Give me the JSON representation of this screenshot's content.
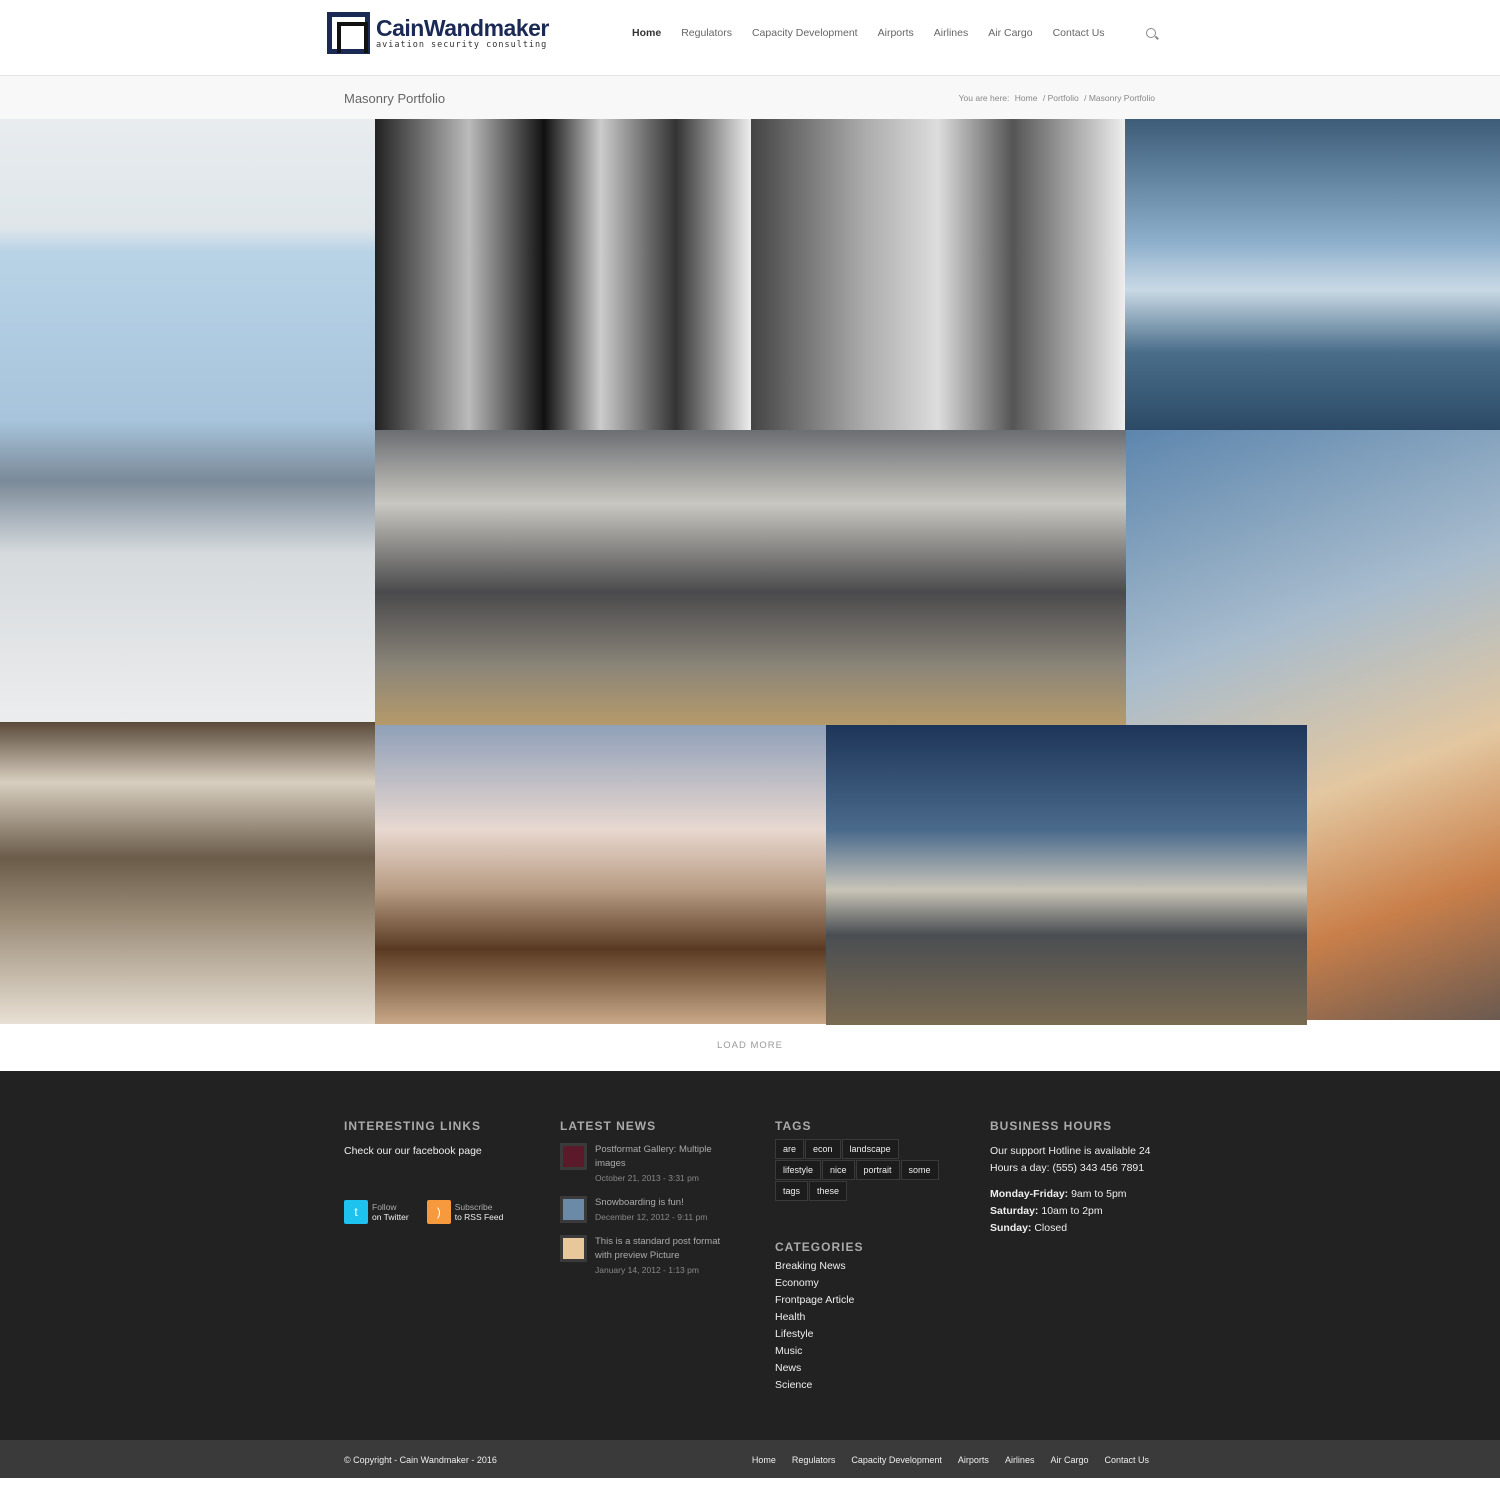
{
  "brand": {
    "name": "CainWandmaker",
    "tagline": "aviation security consulting"
  },
  "nav": [
    "Home",
    "Regulators",
    "Capacity Development",
    "Airports",
    "Airlines",
    "Air Cargo",
    "Contact Us"
  ],
  "page_title": "Masonry Portfolio",
  "breadcrumb": {
    "prefix": "You are here:",
    "items": [
      "Home",
      "/ Portfolio",
      "/ Masonry Portfolio"
    ]
  },
  "load_more": "LOAD MORE",
  "footer": {
    "links": {
      "title": "INTERESTING LINKS",
      "text": "Check our our facebook page",
      "twitter": [
        "Follow",
        "on Twitter"
      ],
      "rss": [
        "Subscribe",
        "to RSS Feed"
      ]
    },
    "news": {
      "title": "LATEST NEWS",
      "items": [
        {
          "title": "Postformat Gallery: Multiple images",
          "date": "October 21, 2013 - 3:31 pm"
        },
        {
          "title": "Snowboarding is fun!",
          "date": "December 12, 2012 - 9:11 pm"
        },
        {
          "title": "This is a standard post format with preview Picture",
          "date": "January 14, 2012 - 1:13 pm"
        }
      ]
    },
    "tags": {
      "title": "TAGS",
      "items": [
        "are",
        "econ",
        "landscape",
        "lifestyle",
        "nice",
        "portrait",
        "some",
        "tags",
        "these"
      ]
    },
    "categories": {
      "title": "CATEGORIES",
      "items": [
        "Breaking News",
        "Economy",
        "Frontpage Article",
        "Health",
        "Lifestyle",
        "Music",
        "News",
        "Science"
      ]
    },
    "hours": {
      "title": "BUSINESS HOURS",
      "text": "Our support Hotline is available 24 Hours a day: (555) 343 456 7891",
      "rows": [
        [
          "Monday-Friday:",
          "9am to 5pm"
        ],
        [
          "Saturday:",
          "10am to 2pm"
        ],
        [
          "Sunday:",
          "Closed"
        ]
      ]
    }
  },
  "copyright": "© Copyright - Cain Wandmaker - 2016",
  "colors": {
    "twitter": "#1dc2ef",
    "rss": "#f79a3e",
    "footer": "#222222"
  }
}
